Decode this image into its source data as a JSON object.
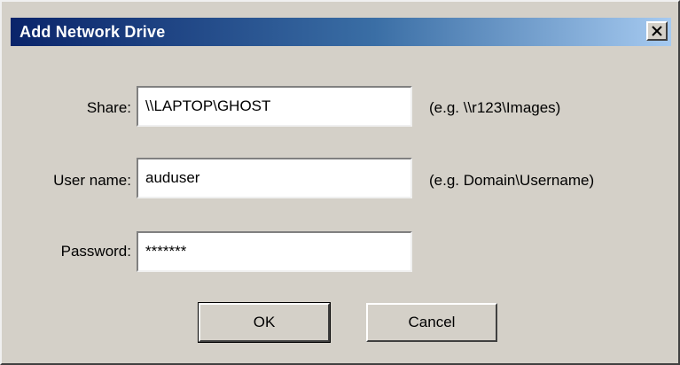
{
  "window": {
    "title": "Add Network Drive",
    "close_glyph": "✕"
  },
  "form": {
    "share": {
      "label": "Share:",
      "value": "\\\\LAPTOP\\GHOST",
      "hint": "(e.g. \\\\r123\\Images)"
    },
    "username": {
      "label": "User name:",
      "value": "auduser",
      "hint": "(e.g. Domain\\Username)"
    },
    "password": {
      "label": "Password:",
      "value": "*******"
    }
  },
  "buttons": {
    "ok_label": "OK",
    "cancel_label": "Cancel"
  }
}
